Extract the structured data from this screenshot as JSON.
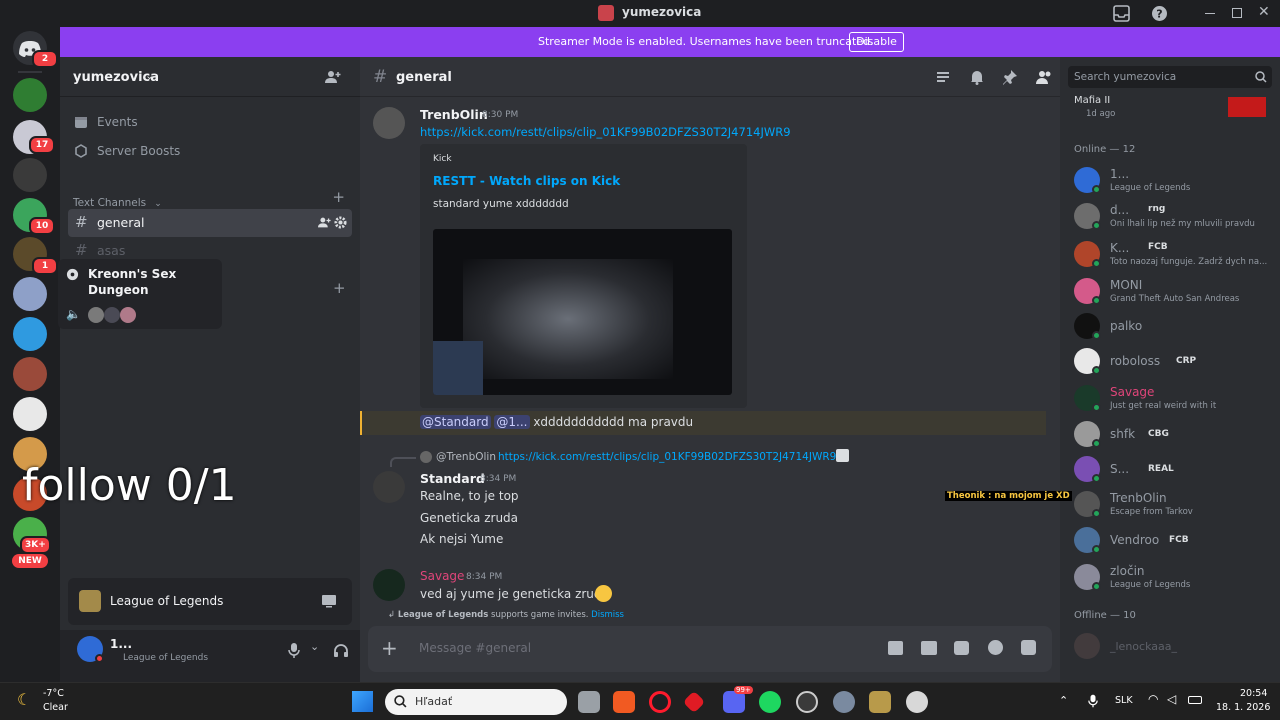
{
  "window": {
    "title": "yumezovica"
  },
  "banner": {
    "message": "Streamer Mode is enabled. Usernames have been truncated.",
    "button": "Disable"
  },
  "rail": {
    "home_badge": "2",
    "badges": [
      "17",
      "1",
      "10",
      "1",
      "3K+"
    ],
    "new_label": "NEW"
  },
  "overlay_text": "follow 0/1",
  "server": {
    "name": "yumezovica",
    "events": "Events",
    "boosts": "Server Boosts",
    "text_channels": "Text Channels",
    "channels": [
      "general",
      "asas"
    ],
    "voice_popup_title": "Kreonn's Sex Dungeon"
  },
  "activity": {
    "game": "League of Legends"
  },
  "user": {
    "name": "1...",
    "status": "League of Legends"
  },
  "chat": {
    "channel": "general",
    "search_placeholder": "Search yumezovica",
    "input_placeholder": "Message #general",
    "invite_notice": "supports game invites.",
    "invite_game": "League of Legends",
    "dismiss": "Dismiss",
    "messages": [
      {
        "author": "TrenbOlin",
        "time": "8:30 PM",
        "link": "https://kick.com/restt/clips/clip_01KF99B02DFZS30T2J4714JWR9",
        "embed": {
          "provider": "Kick",
          "title": "RESTT - Watch clips on Kick",
          "description": "standard yume xddddddd"
        }
      },
      {
        "mention1": "@Standard",
        "mention2": "@1...",
        "text": "xddddddddddd ma pravdu"
      },
      {
        "reply_author": "@TrenbOlin",
        "reply_link": "https://kick.com/restt/clips/clip_01KF99B02DFZS30T2J4714JWR9",
        "author": "Standard",
        "time": "8:34 PM",
        "lines": [
          "Realne, to je top",
          "Geneticka zruda",
          "Ak nejsi Yume"
        ]
      },
      {
        "author": "Savage",
        "time": "8:34 PM",
        "text": "ved aj yume je geneticka zruda"
      }
    ]
  },
  "members": {
    "top_item": {
      "name": "Mafia II",
      "sub": "1d ago"
    },
    "online_header": "Online — 12",
    "offline_header": "Offline — 10",
    "online": [
      {
        "name": "1...",
        "tag": "",
        "sub": "League of Legends",
        "color": "#2f6bd6"
      },
      {
        "name": "d...",
        "tag": "rng",
        "sub": "Oni lhali lip než my mluvili pravdu",
        "color": "#6d6d6d"
      },
      {
        "name": "K...",
        "tag": "FCB",
        "sub": "Toto naozaj funguje. Zadrž dych na...",
        "color": "#b0452a"
      },
      {
        "name": "MONI",
        "tag": "",
        "sub": "Grand Theft Auto San Andreas",
        "color": "#d45a8a"
      },
      {
        "name": "palko",
        "tag": "",
        "sub": "",
        "color": "#111111"
      },
      {
        "name": "roboloss",
        "tag": "CRP",
        "sub": "",
        "color": "#e8e8e8"
      },
      {
        "name": "Savage",
        "tag": "",
        "sub": "Just get real weird with it",
        "color": "#1a3a2a"
      },
      {
        "name": "shfk",
        "tag": "CBG",
        "sub": "",
        "color": "#9a9a9a"
      },
      {
        "name": "S...",
        "tag": "REAL",
        "sub": "",
        "color": "#7a4fb3"
      },
      {
        "name": "TrenbOlin",
        "tag": "",
        "sub": "Escape from Tarkov",
        "color": "#555555"
      },
      {
        "name": "Vendroo",
        "tag": "FCB",
        "sub": "",
        "color": "#4a6f9a"
      },
      {
        "name": "zločin",
        "tag": "",
        "sub": "League of Legends",
        "color": "#8a8a9a"
      }
    ],
    "offline_first": "_lenockaaa_",
    "overlay_chat": "Theonik : na mojom je XD"
  },
  "taskbar": {
    "weather_temp": "-7°C",
    "weather_desc": "Clear",
    "search_placeholder": "Hľadať",
    "lang": "SLK",
    "time": "20:54",
    "date": "18. 1. 2026",
    "discord_badge": "99+"
  }
}
